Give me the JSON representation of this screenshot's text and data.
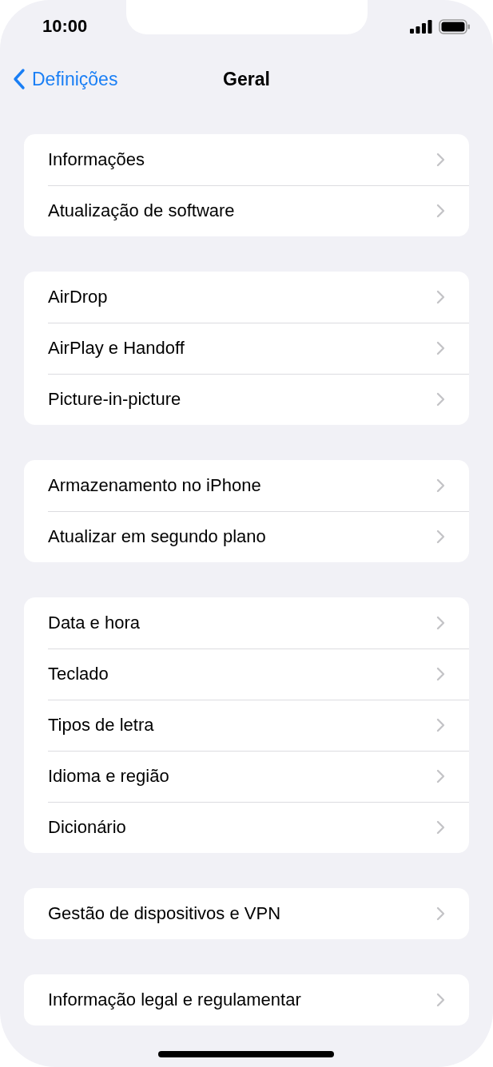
{
  "status_bar": {
    "time": "10:00"
  },
  "navigation": {
    "back_label": "Definições",
    "title": "Geral"
  },
  "groups": [
    {
      "items": [
        {
          "label": "Informações"
        },
        {
          "label": "Atualização de software"
        }
      ]
    },
    {
      "items": [
        {
          "label": "AirDrop"
        },
        {
          "label": "AirPlay e Handoff"
        },
        {
          "label": "Picture-in-picture"
        }
      ]
    },
    {
      "items": [
        {
          "label": "Armazenamento no iPhone"
        },
        {
          "label": "Atualizar em segundo plano"
        }
      ]
    },
    {
      "items": [
        {
          "label": "Data e hora"
        },
        {
          "label": "Teclado"
        },
        {
          "label": "Tipos de letra"
        },
        {
          "label": "Idioma e região"
        },
        {
          "label": "Dicionário"
        }
      ]
    },
    {
      "items": [
        {
          "label": "Gestão de dispositivos e VPN"
        }
      ]
    },
    {
      "items": [
        {
          "label": "Informação legal e regulamentar"
        }
      ]
    }
  ]
}
